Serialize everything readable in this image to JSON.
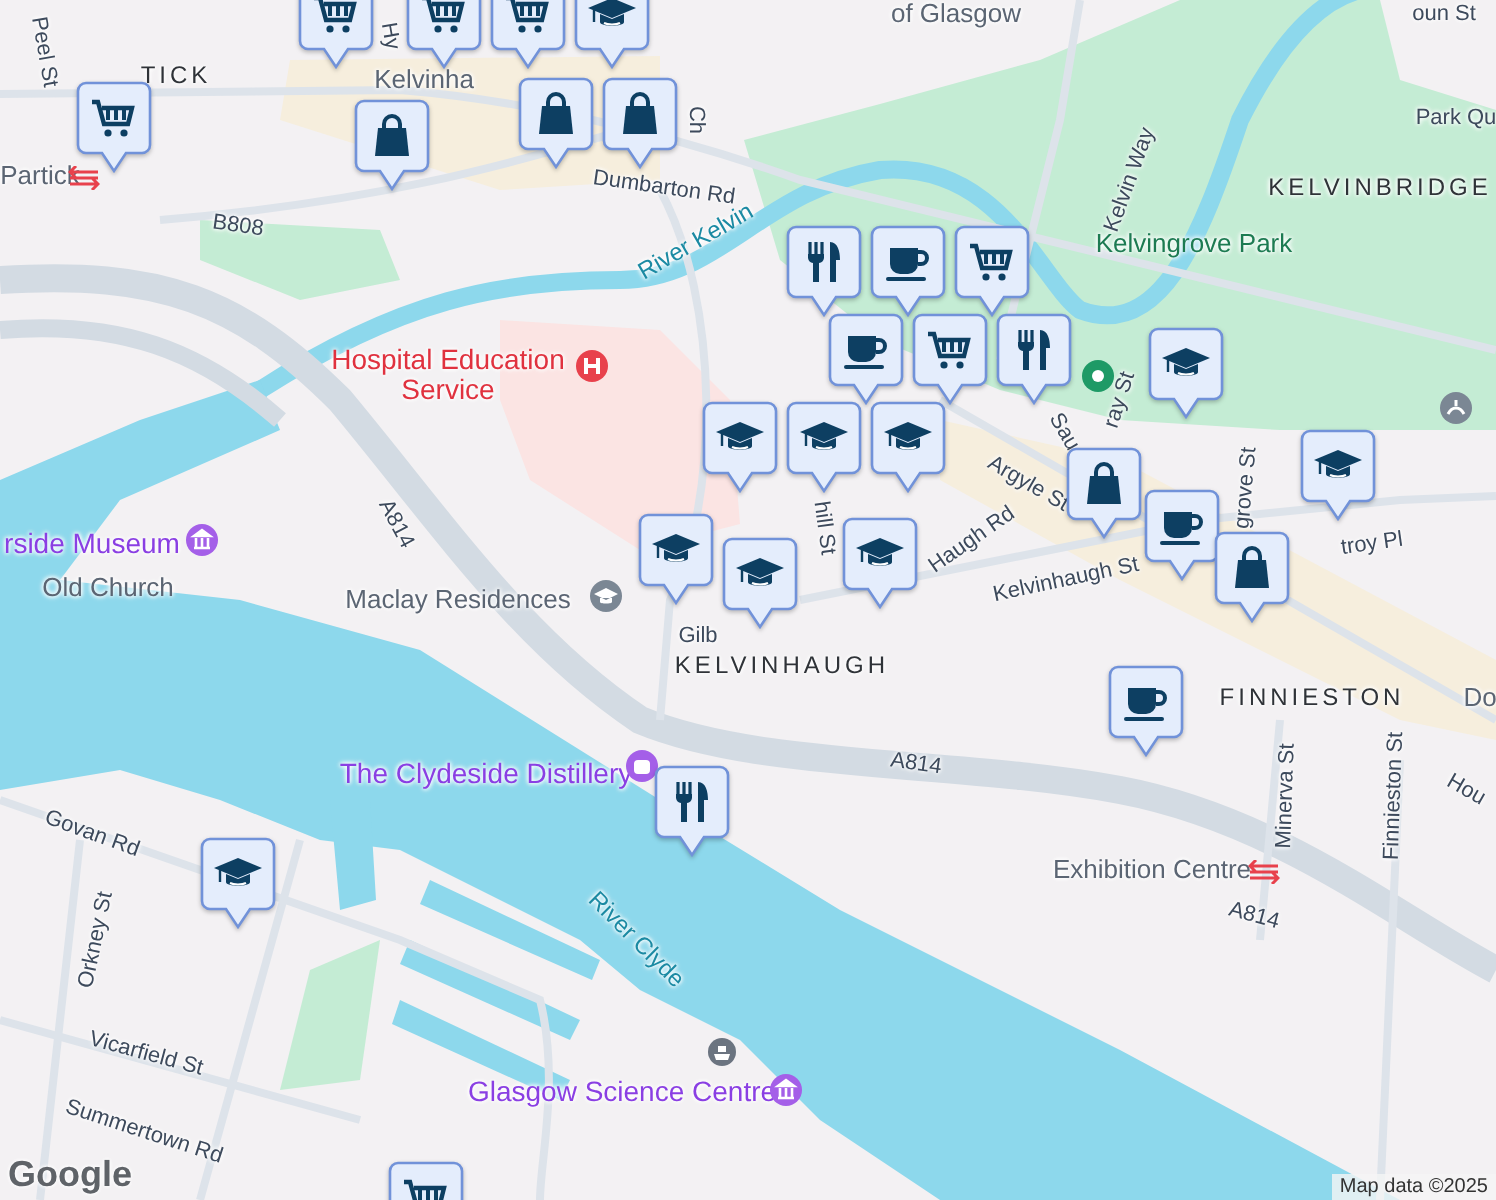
{
  "map": {
    "labels": [
      {
        "text": "of Glasgow",
        "kind": "place"
      },
      {
        "text": "oun St",
        "kind": "road"
      },
      {
        "text": "Peel St",
        "kind": "road"
      },
      {
        "text": "TICK",
        "kind": "district"
      },
      {
        "text": "Partick",
        "kind": "place"
      },
      {
        "text": "Hy",
        "kind": "road"
      },
      {
        "text": "Kelvinha",
        "kind": "place"
      },
      {
        "text": "Ch",
        "kind": "road"
      },
      {
        "text": "Dumbarton Rd",
        "kind": "road"
      },
      {
        "text": "B808",
        "kind": "road"
      },
      {
        "text": "River Kelvin",
        "kind": "water"
      },
      {
        "text": "Kelvin Way",
        "kind": "road"
      },
      {
        "text": "Park Qu",
        "kind": "road"
      },
      {
        "text": "KELVINBRIDGE",
        "kind": "district"
      },
      {
        "text": "Kelvingrove Park",
        "kind": "park"
      },
      {
        "text": "Hospital Education Service",
        "kind": "hospital"
      },
      {
        "text": "A814",
        "kind": "road"
      },
      {
        "text": "rside Museum",
        "kind": "poi"
      },
      {
        "text": "Old Church",
        "kind": "place"
      },
      {
        "text": "Maclay Residences",
        "kind": "place"
      },
      {
        "text": "Gilb",
        "kind": "road"
      },
      {
        "text": "hill St",
        "kind": "road"
      },
      {
        "text": "Haugh Rd",
        "kind": "road"
      },
      {
        "text": "Argyle St",
        "kind": "road"
      },
      {
        "text": "Sau",
        "kind": "road"
      },
      {
        "text": "ray St",
        "kind": "road"
      },
      {
        "text": "grove St",
        "kind": "road"
      },
      {
        "text": "troy Pl",
        "kind": "road"
      },
      {
        "text": "Kelvinhaugh St",
        "kind": "road"
      },
      {
        "text": "KELVINHAUGH",
        "kind": "district"
      },
      {
        "text": "FINNIESTON",
        "kind": "district"
      },
      {
        "text": "Do",
        "kind": "place"
      },
      {
        "text": "The Clydeside Distillery",
        "kind": "poi"
      },
      {
        "text": "A814",
        "kind": "road"
      },
      {
        "text": "Minerva St",
        "kind": "road"
      },
      {
        "text": "Finnieston St",
        "kind": "road"
      },
      {
        "text": "Hou",
        "kind": "road"
      },
      {
        "text": "Exhibition Centre",
        "kind": "place"
      },
      {
        "text": "A814",
        "kind": "road"
      },
      {
        "text": "Govan Rd",
        "kind": "road"
      },
      {
        "text": "Orkney St",
        "kind": "road"
      },
      {
        "text": "River Clyde",
        "kind": "water"
      },
      {
        "text": "Vicarfield St",
        "kind": "road"
      },
      {
        "text": "Glasgow Science Centre",
        "kind": "poi"
      },
      {
        "text": "Summertown Rd",
        "kind": "road"
      }
    ],
    "markers": [
      {
        "kind": "cart"
      },
      {
        "kind": "bag"
      },
      {
        "kind": "cart"
      },
      {
        "kind": "cart"
      },
      {
        "kind": "cart"
      },
      {
        "kind": "cap"
      },
      {
        "kind": "bag"
      },
      {
        "kind": "bag"
      },
      {
        "kind": "cup"
      },
      {
        "kind": "cutlery"
      },
      {
        "kind": "cart"
      },
      {
        "kind": "cup"
      },
      {
        "kind": "cart"
      },
      {
        "kind": "cutlery"
      },
      {
        "kind": "cap"
      },
      {
        "kind": "cap"
      },
      {
        "kind": "cap"
      },
      {
        "kind": "cap"
      },
      {
        "kind": "cap"
      },
      {
        "kind": "cap"
      },
      {
        "kind": "cap"
      },
      {
        "kind": "bag"
      },
      {
        "kind": "cup"
      },
      {
        "kind": "bag"
      },
      {
        "kind": "cap"
      },
      {
        "kind": "cup"
      },
      {
        "kind": "cutlery"
      },
      {
        "kind": "cap"
      },
      {
        "kind": "cart"
      }
    ],
    "logo": "Google",
    "attribution": "Map data ©2025"
  }
}
